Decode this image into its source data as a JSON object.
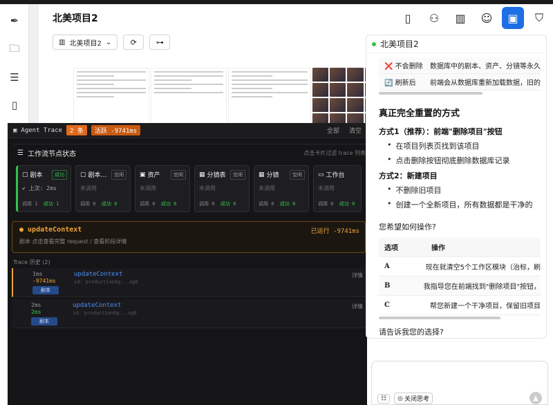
{
  "page": {
    "title": "北美项目2"
  },
  "toolbar": {
    "project_select": "北美项目2"
  },
  "trace": {
    "title": "Agent Trace",
    "count_badge": "2 条",
    "active_badge": "活跃 -9741ms",
    "filter_all": "全部",
    "clear": "清空",
    "workflow_title": "工作流节点状态",
    "workflow_hint": "点击卡片过滤 trace 列表",
    "nodes": [
      {
        "name": "剧本",
        "status": "成功",
        "mid": "上次: 2ms",
        "calls": "调用 1",
        "success": "成功 1"
      },
      {
        "name": "剧本…",
        "status": "空闲",
        "mid": "未调用",
        "calls": "调用 0",
        "success": "成功 0"
      },
      {
        "name": "资产",
        "status": "空闲",
        "mid": "未调用",
        "calls": "调用 0",
        "success": "成功 0"
      },
      {
        "name": "分镜表",
        "status": "空闲",
        "mid": "未调用",
        "calls": "调用 0",
        "success": "成功 0"
      },
      {
        "name": "分镜",
        "status": "空闲",
        "mid": "未调用",
        "calls": "调用 0",
        "success": "成功 0"
      },
      {
        "name": "工作台",
        "status": "空闲",
        "mid": "未调用",
        "calls": "调用 0",
        "success": "成功 0"
      }
    ],
    "update": {
      "name": "updateContext",
      "ran": "已运行 -9741ms",
      "sub": "剧本   点击查看完整 request / 查看阶段详情"
    },
    "history_title": "Trace 历史 (2)",
    "history": [
      {
        "a": "1ms",
        "b": "-9741ms",
        "tag": "剧本",
        "fn": "updateContext",
        "id": "id: productionAg...og6",
        "detail": "详情"
      },
      {
        "a": "2ms",
        "b": "2ms",
        "tag": "剧本",
        "fn": "updateContext",
        "id": "id: productionAg...og6",
        "detail": "详情"
      }
    ]
  },
  "chat": {
    "title": "北美项目2",
    "top_rows": [
      {
        "c1": "❌ 不会删除",
        "c2": "数据库中的剧本、资产、分镜等永久"
      },
      {
        "c1": "🔄 刷新后",
        "c2": "前端会从数据库重新加载数据，旧的"
      }
    ],
    "heading": "真正完全重置的方式",
    "m1_title": "方式1（推荐）：前端\"删除项目\"按钮",
    "m1_items": [
      "在项目列表页找到该项目",
      "点击删除按钮彻底删除数据库记录"
    ],
    "m2_title": "方式2：新建项目",
    "m2_items": [
      "不删除旧项目",
      "创建一个全新项目，所有数据都是干净的"
    ],
    "question": "您希望如何操作?",
    "opt_header": {
      "c1": "选项",
      "c2": "操作"
    },
    "options": [
      {
        "c1": "A",
        "c2": "现在就清空5个工作区模块（治标，刷"
      },
      {
        "c1": "B",
        "c2": "我指导您在前端找到\"删除项目\"按钮，"
      },
      {
        "c1": "C",
        "c2": "帮您新建一个干净项目，保留旧项目"
      }
    ],
    "footer": "请告诉我您的选择?"
  },
  "input": {
    "think_toggle": "关闭思考"
  }
}
